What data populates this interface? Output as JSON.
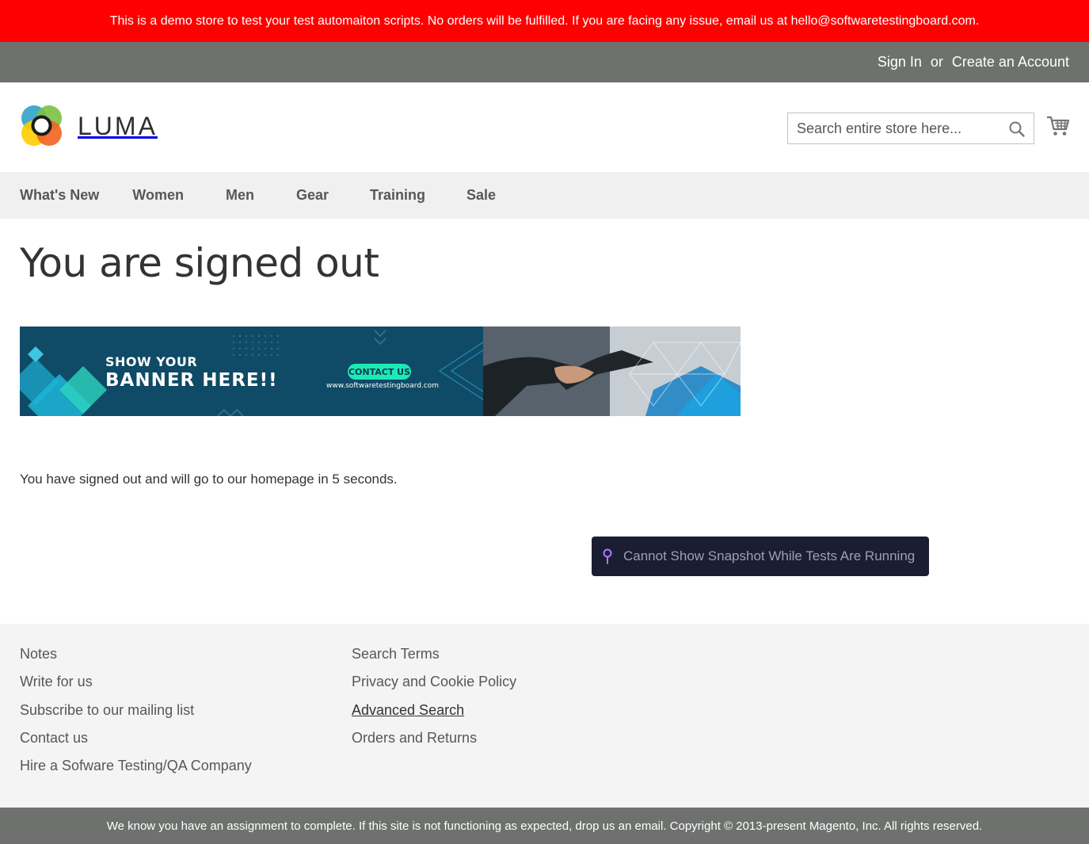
{
  "notice": {
    "text": "This is a demo store to test your test automaiton scripts. No orders will be fulfilled. If you are facing any issue, email us at hello@softwaretestingboard.com."
  },
  "header_links": {
    "sign_in": "Sign In",
    "or": "or",
    "create_account": "Create an Account"
  },
  "logo": {
    "text": "LUMA"
  },
  "search": {
    "placeholder": "Search entire store here..."
  },
  "nav": {
    "items": [
      {
        "label": "What's New"
      },
      {
        "label": "Women"
      },
      {
        "label": "Men"
      },
      {
        "label": "Gear"
      },
      {
        "label": "Training"
      },
      {
        "label": "Sale"
      }
    ]
  },
  "main": {
    "title": "You are signed out",
    "banner": {
      "line1": "SHOW YOUR",
      "line2": "BANNER HERE!!",
      "button": "CONTACT US",
      "url": "www.softwaretestingboard.com"
    },
    "message": "You have signed out and will go to our homepage in 5 seconds."
  },
  "snapshot": {
    "text": "Cannot Show Snapshot While Tests Are Running"
  },
  "footer": {
    "col1": [
      {
        "label": "Notes"
      },
      {
        "label": "Write for us"
      },
      {
        "label": "Subscribe to our mailing list"
      },
      {
        "label": "Contact us"
      },
      {
        "label": "Hire a Sofware Testing/QA Company"
      }
    ],
    "col2": [
      {
        "label": "Search Terms"
      },
      {
        "label": "Privacy and Cookie Policy"
      },
      {
        "label": "Advanced Search"
      },
      {
        "label": "Orders and Returns"
      }
    ]
  },
  "copyright": {
    "text": "We know you have an assignment to complete. If this site is not functioning as expected, drop us an email. Copyright © 2013-present Magento, Inc. All rights reserved."
  },
  "colors": {
    "notice_bg": "#ff0000",
    "panel_bg": "#6e716e",
    "nav_bg": "#f0f0f0",
    "footer_bg": "#f4f4f4",
    "banner_bg": "#0f4a66",
    "banner_accent": "#1de9b6",
    "snapshot_bg": "#1b1e32"
  }
}
